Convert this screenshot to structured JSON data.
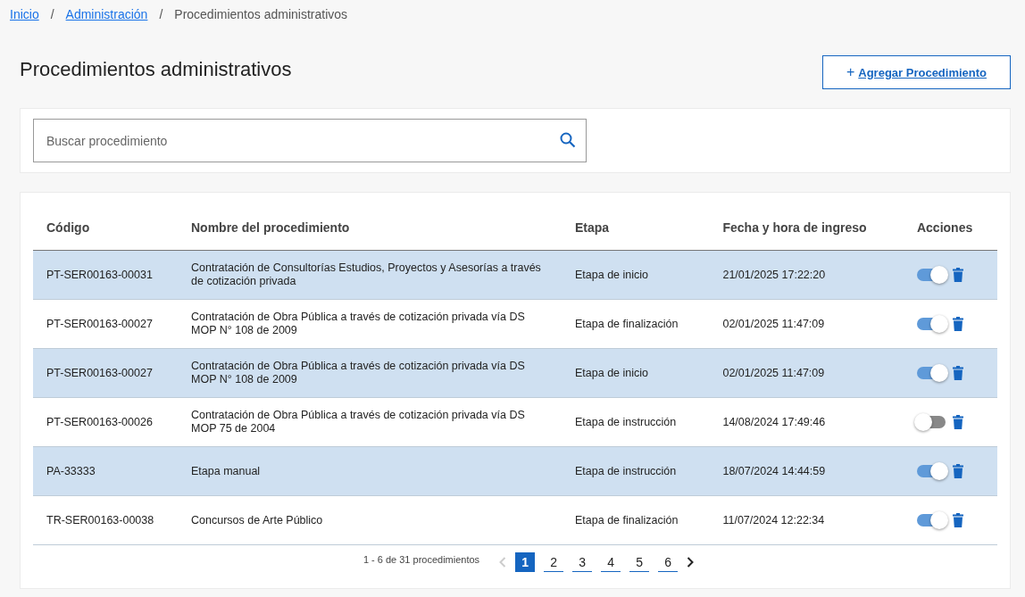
{
  "breadcrumb": [
    {
      "label": "Inicio",
      "link": true
    },
    {
      "label": "Administración",
      "link": true
    },
    {
      "label": "Procedimientos administrativos",
      "link": false
    }
  ],
  "breadcrumb_separator": "/",
  "page_title": "Procedimientos administrativos",
  "add_button": {
    "icon": "+",
    "label": "Agregar Procedimiento"
  },
  "search": {
    "placeholder": "Buscar procedimiento"
  },
  "table": {
    "columns": [
      "Código",
      "Nombre del procedimiento",
      "Etapa",
      "Fecha y hora de ingreso",
      "Acciones"
    ],
    "rows": [
      {
        "code": "PT-SER00163-00031",
        "name": "Contratación de Consultorías Estudios, Proyectos y Asesorías a través de cotización privada",
        "stage": "Etapa de inicio",
        "date": "21/01/2025 17:22:20",
        "on": true
      },
      {
        "code": "PT-SER00163-00027",
        "name": "Contratación de Obra Pública a través de cotización privada vía DS MOP N° 108 de 2009",
        "stage": "Etapa de finalización",
        "date": "02/01/2025 11:47:09",
        "on": true
      },
      {
        "code": "PT-SER00163-00027",
        "name": "Contratación de Obra Pública a través de cotización privada vía DS MOP N° 108 de 2009",
        "stage": "Etapa de inicio",
        "date": "02/01/2025 11:47:09",
        "on": true
      },
      {
        "code": "PT-SER00163-00026",
        "name": "Contratación de Obra Pública a través de cotización privada vía DS MOP 75 de 2004",
        "stage": "Etapa de instrucción",
        "date": "14/08/2024 17:49:46",
        "on": false
      },
      {
        "code": "PA-33333",
        "name": "Etapa manual",
        "stage": "Etapa de instrucción",
        "date": "18/07/2024 14:44:59",
        "on": true
      },
      {
        "code": "TR-SER00163-00038",
        "name": "Concursos de Arte Público",
        "stage": "Etapa de finalización",
        "date": "11/07/2024 12:22:34",
        "on": true
      }
    ]
  },
  "pagination": {
    "summary": "1 - 6 de 31 procedimientos",
    "prev_disabled": true,
    "next_disabled": false,
    "pages": [
      {
        "label": "1",
        "selected": true
      },
      {
        "label": "2",
        "selected": false
      },
      {
        "label": "3",
        "selected": false
      },
      {
        "label": "4",
        "selected": false
      },
      {
        "label": "5",
        "selected": false
      },
      {
        "label": "6",
        "selected": false
      }
    ]
  }
}
